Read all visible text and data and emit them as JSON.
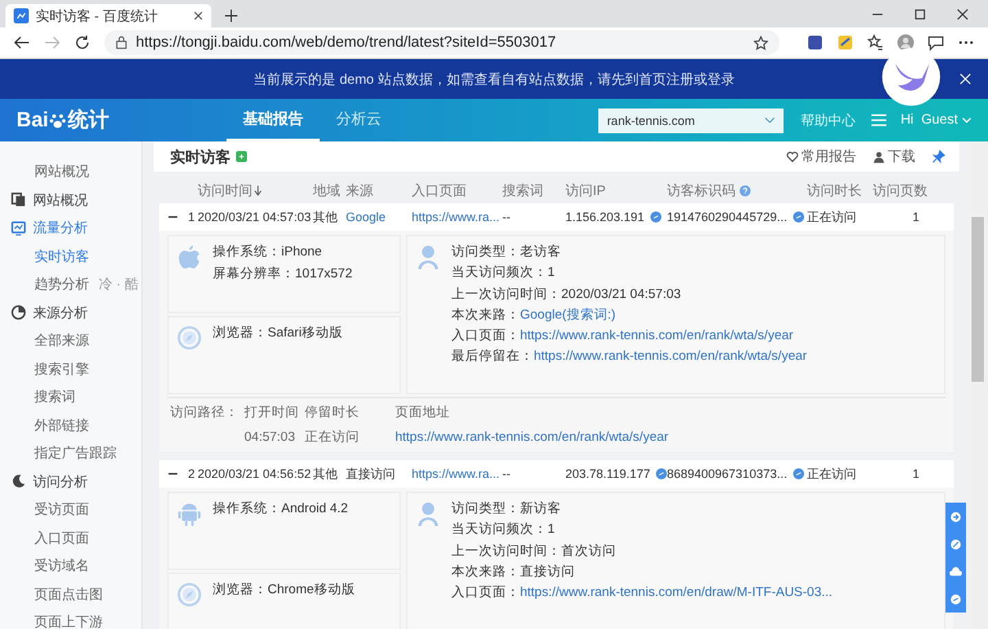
{
  "browser": {
    "tab_title": "实时访客 - 百度统计",
    "url": "https://tongji.baidu.com/web/demo/trend/latest?siteId=5503017"
  },
  "banner": {
    "text": "当前展示的是 demo 站点数据，如需查看自有站点数据，请先到首页注册或登录"
  },
  "nav": {
    "logo_latin": "Bai",
    "logo_cn": "统计",
    "tabs": [
      {
        "label": "基础报告",
        "selected": true
      },
      {
        "label": "分析云",
        "selected": false
      }
    ],
    "site": "rank-tennis.com",
    "help": "帮助中心",
    "user": "Hi  Guest"
  },
  "sidebar": {
    "items": [
      {
        "kind": "sub",
        "label": "网站概况",
        "selected": false
      },
      {
        "kind": "group",
        "label": "网站概况",
        "selected": false
      },
      {
        "kind": "group",
        "label": "流量分析",
        "selected": true
      },
      {
        "kind": "sub",
        "label": "实时访客",
        "selected": true
      },
      {
        "kind": "sub",
        "label": "趋势分析",
        "tag": "冷 · 酷",
        "selected": false
      },
      {
        "kind": "group",
        "label": "来源分析",
        "selected": false
      },
      {
        "kind": "sub",
        "label": "全部来源",
        "selected": false
      },
      {
        "kind": "sub",
        "label": "搜索引擎",
        "selected": false
      },
      {
        "kind": "sub",
        "label": "搜索词",
        "selected": false
      },
      {
        "kind": "sub",
        "label": "外部链接",
        "selected": false
      },
      {
        "kind": "sub",
        "label": "指定广告跟踪",
        "selected": false
      },
      {
        "kind": "group",
        "label": "访问分析",
        "selected": false
      },
      {
        "kind": "sub",
        "label": "受访页面",
        "selected": false
      },
      {
        "kind": "sub",
        "label": "入口页面",
        "selected": false
      },
      {
        "kind": "sub",
        "label": "受访域名",
        "selected": false
      },
      {
        "kind": "sub",
        "label": "页面点击图",
        "selected": false
      },
      {
        "kind": "sub",
        "label": "页面上下游",
        "selected": false
      }
    ]
  },
  "page": {
    "title": "实时访客",
    "actions": [
      "常用报告",
      "下载"
    ]
  },
  "table": {
    "columns": [
      {
        "label": "访问时间",
        "sorted": true,
        "help": false
      },
      {
        "label": "地域",
        "sorted": false,
        "help": false
      },
      {
        "label": "来源",
        "sorted": false,
        "help": false
      },
      {
        "label": "入口页面",
        "sorted": false,
        "help": false
      },
      {
        "label": "搜索词",
        "sorted": false,
        "help": false
      },
      {
        "label": "访问IP",
        "sorted": false,
        "help": false
      },
      {
        "label": "访客标识码",
        "sorted": false,
        "help": true
      },
      {
        "label": "访问时长",
        "sorted": false,
        "help": false
      },
      {
        "label": "访问页数",
        "sorted": false,
        "help": false
      }
    ],
    "rows": [
      {
        "index": "1",
        "expanded": true,
        "time": "2020/03/21 04:57:03",
        "region": "其他",
        "source": "Google",
        "source_link": true,
        "entry": "https://www.ra...",
        "keyword": "--",
        "ip": "1.156.203.191",
        "visitor_id": "1914760290445729...",
        "duration": "正在访问",
        "pages": "1",
        "detail": {
          "device": {
            "kind": "ios",
            "lines": [
              {
                "label": "操作系统：",
                "value": "iPhone"
              },
              {
                "label": "屏幕分辨率：",
                "value": "1017x572"
              }
            ]
          },
          "browser": {
            "label": "浏览器：",
            "value": "Safari移动版"
          },
          "info": [
            {
              "label": "访问类型：",
              "value": "老访客",
              "link": false
            },
            {
              "label": "当天访问频次：",
              "value": "1",
              "link": false
            },
            {
              "label": "上一次访问时间：",
              "value": "2020/03/21 04:57:03",
              "link": false
            },
            {
              "label": "本次来路：",
              "value": "Google(搜索词:)",
              "link": true
            },
            {
              "label": "入口页面：",
              "value": "https://www.rank-tennis.com/en/rank/wta/s/year",
              "link": true
            },
            {
              "label": "最后停留在：",
              "value": "https://www.rank-tennis.com/en/rank/wta/s/year",
              "link": true
            }
          ],
          "path": {
            "label": "访问路径：",
            "headers": [
              "打开时间",
              "停留时长",
              "页面地址"
            ],
            "entries": [
              {
                "time": "04:57:03",
                "stay": "正在访问",
                "url": "https://www.rank-tennis.com/en/rank/wta/s/year"
              }
            ]
          }
        }
      },
      {
        "index": "2",
        "expanded": true,
        "time": "2020/03/21 04:56:52",
        "region": "其他",
        "source": "直接访问",
        "source_link": false,
        "entry": "https://www.ra...",
        "keyword": "--",
        "ip": "203.78.119.177",
        "visitor_id": "8689400967310373...",
        "duration": "正在访问",
        "pages": "1",
        "detail": {
          "device": {
            "kind": "android",
            "lines": [
              {
                "label": "操作系统：",
                "value": "Android 4.2"
              }
            ]
          },
          "browser": {
            "label": "浏览器：",
            "value": "Chrome移动版"
          },
          "info": [
            {
              "label": "访问类型：",
              "value": "新访客",
              "link": false
            },
            {
              "label": "当天访问频次：",
              "value": "1",
              "link": false
            },
            {
              "label": "上一次访问时间：",
              "value": "首次访问",
              "link": false
            },
            {
              "label": "本次来路：",
              "value": "直接访问",
              "link": false
            },
            {
              "label": "入口页面：",
              "value": "https://www.rank-tennis.com/en/draw/M-ITF-AUS-03...",
              "link": true
            }
          ]
        }
      }
    ]
  }
}
